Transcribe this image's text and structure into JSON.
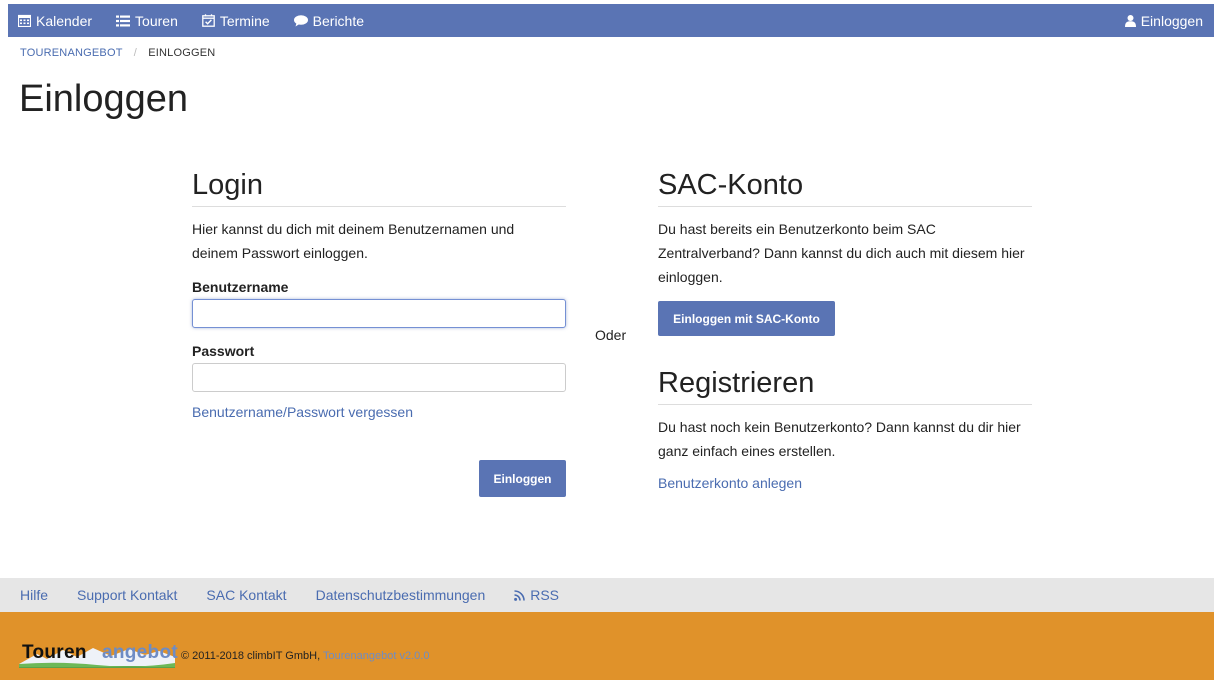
{
  "nav": {
    "items": [
      {
        "label": "Kalender",
        "icon": "calendar-icon"
      },
      {
        "label": "Touren",
        "icon": "list-icon"
      },
      {
        "label": "Termine",
        "icon": "calendar-check-icon"
      },
      {
        "label": "Berichte",
        "icon": "comment-icon"
      }
    ],
    "login_label": "Einloggen",
    "bg_color": "#5a74b4"
  },
  "breadcrumb": {
    "items": [
      "TOURENANGEBOT",
      "EINLOGGEN"
    ],
    "separator": "/"
  },
  "page_title": "Einloggen",
  "login": {
    "title": "Login",
    "description": "Hier kannst du dich mit deinem Benutzernamen und deinem Passwort einloggen.",
    "username_label": "Benutzername",
    "username_value": "",
    "password_label": "Passwort",
    "password_value": "",
    "forgot_link": "Benutzername/Passwort vergessen",
    "submit_label": "Einloggen"
  },
  "or_label": "Oder",
  "sac": {
    "title": "SAC-Konto",
    "description": "Du hast bereits ein Benutzerkonto beim SAC Zentralverband? Dann kannst du dich auch mit diesem hier einloggen.",
    "button_label": "Einloggen mit SAC-Konto"
  },
  "register": {
    "title": "Registrieren",
    "description": "Du hast noch kein Benutzerkonto? Dann kannst du dir hier ganz einfach eines erstellen.",
    "link": "Benutzerkonto anlegen"
  },
  "footer": {
    "links": [
      "Hilfe",
      "Support Kontakt",
      "SAC Kontakt",
      "Datenschutzbestimmungen",
      "RSS"
    ],
    "logo_part1": "Touren",
    "logo_part2": "angebot",
    "copyright": "© 2011-2018 climbIT GmbH,",
    "version": "Tourenangebot v2.0.0",
    "bg_color": "#e0922a"
  }
}
